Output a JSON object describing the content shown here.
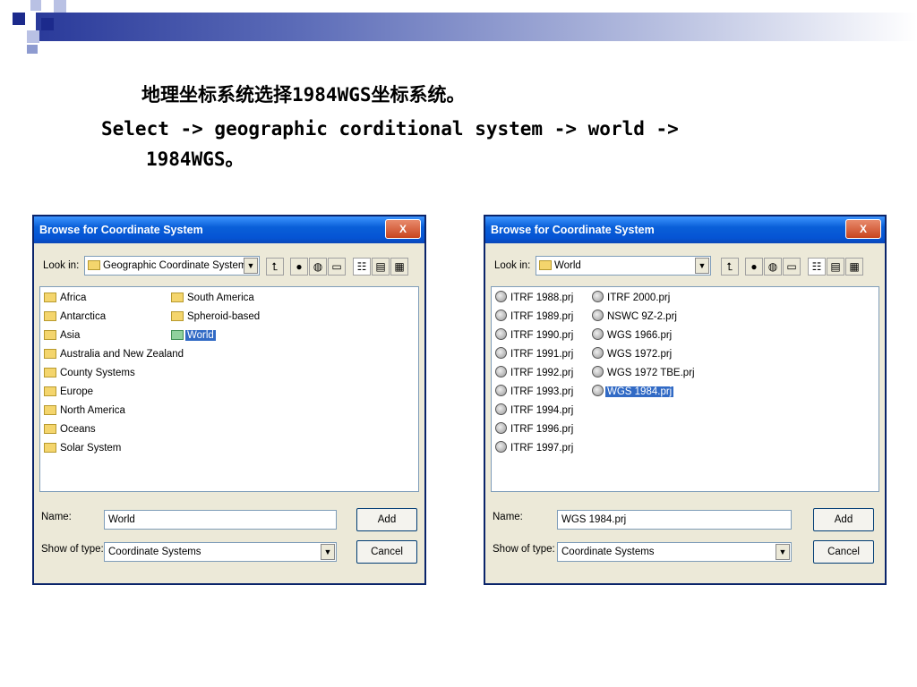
{
  "caption": {
    "line1": "地理坐标系统选择1984WGS坐标系统。",
    "line2": "Select -> geographic corditional system -> world ->",
    "line3": "1984WGS。"
  },
  "dialogs": [
    {
      "title": "Browse for Coordinate System",
      "close_label": "X",
      "look_in_label": "Look in:",
      "look_in_value": "Geographic Coordinate Systems",
      "items": [
        {
          "label": "Africa",
          "icon": "folder-icon"
        },
        {
          "label": "Antarctica",
          "icon": "folder-icon"
        },
        {
          "label": "Asia",
          "icon": "folder-icon"
        },
        {
          "label": "Australia and New Zealand",
          "icon": "folder-icon"
        },
        {
          "label": "County Systems",
          "icon": "folder-icon"
        },
        {
          "label": "Europe",
          "icon": "folder-icon"
        },
        {
          "label": "North America",
          "icon": "folder-icon"
        },
        {
          "label": "Oceans",
          "icon": "folder-icon"
        },
        {
          "label": "Solar System",
          "icon": "folder-icon"
        },
        {
          "label": "South America",
          "icon": "folder-icon"
        },
        {
          "label": "Spheroid-based",
          "icon": "folder-icon"
        },
        {
          "label": "World",
          "icon": "folder-icon",
          "selected": true
        }
      ],
      "name_label": "Name:",
      "name_value": "World",
      "type_label": "Show of type:",
      "type_value": "Coordinate Systems",
      "add_label": "Add",
      "cancel_label": "Cancel"
    },
    {
      "title": "Browse for Coordinate System",
      "close_label": "X",
      "look_in_label": "Look in:",
      "look_in_value": "World",
      "items": [
        {
          "label": "ITRF 1988.prj",
          "icon": "globe-icon"
        },
        {
          "label": "ITRF 1989.prj",
          "icon": "globe-icon"
        },
        {
          "label": "ITRF 1990.prj",
          "icon": "globe-icon"
        },
        {
          "label": "ITRF 1991.prj",
          "icon": "globe-icon"
        },
        {
          "label": "ITRF 1992.prj",
          "icon": "globe-icon"
        },
        {
          "label": "ITRF 1993.prj",
          "icon": "globe-icon"
        },
        {
          "label": "ITRF 1994.prj",
          "icon": "globe-icon"
        },
        {
          "label": "ITRF 1996.prj",
          "icon": "globe-icon"
        },
        {
          "label": "ITRF 1997.prj",
          "icon": "globe-icon"
        },
        {
          "label": "ITRF 2000.prj",
          "icon": "globe-icon"
        },
        {
          "label": "NSWC 9Z-2.prj",
          "icon": "globe-icon"
        },
        {
          "label": "WGS 1966.prj",
          "icon": "globe-icon"
        },
        {
          "label": "WGS 1972.prj",
          "icon": "globe-icon"
        },
        {
          "label": "WGS 1972 TBE.prj",
          "icon": "globe-icon"
        },
        {
          "label": "WGS 1984.prj",
          "icon": "globe-icon",
          "selected": true
        }
      ],
      "name_label": "Name:",
      "name_value": "WGS 1984.prj",
      "type_label": "Show of type:",
      "type_value": "Coordinate Systems",
      "add_label": "Add",
      "cancel_label": "Cancel"
    }
  ],
  "colors": {
    "title_bar": "#0554d4",
    "selection": "#316ac5",
    "folder": "#f4d56d"
  }
}
